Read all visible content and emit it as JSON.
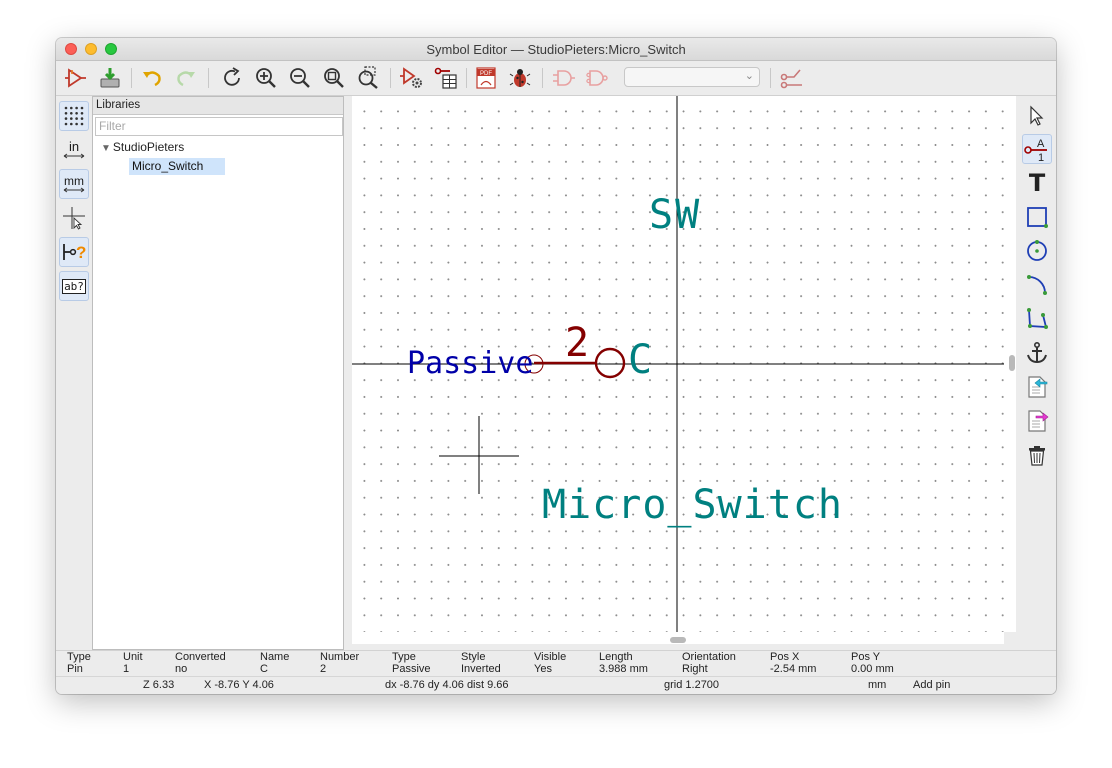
{
  "window": {
    "title": "Symbol Editor — StudioPieters:Micro_Switch"
  },
  "toolbar": {
    "buttons": [
      "new-symbol",
      "save",
      "undo",
      "redo",
      "refresh",
      "zoom-in",
      "zoom-out",
      "zoom-fit",
      "zoom-selection",
      "symbol-properties",
      "pin-table",
      "export-pdf",
      "check-symbol",
      "demorgan-standard",
      "demorgan-alternate",
      "unit-selector",
      "show-pin-electrical-type"
    ],
    "unit_combo_value": ""
  },
  "left_tools": [
    "grid",
    "in",
    "mm",
    "full-cursor",
    "pin-electrical-type",
    "text-properties"
  ],
  "left_tool_labels": {
    "in": "in",
    "mm": "mm",
    "text_props": "ab?"
  },
  "libraries": {
    "header": "Libraries",
    "filter_placeholder": "Filter",
    "library": "StudioPieters",
    "symbol": "Micro_Switch"
  },
  "canvas": {
    "reference": "SW",
    "value": "Micro_Switch",
    "pin_number": "2",
    "pin_name": "C",
    "pin_type_label": "Passive"
  },
  "right_tools": [
    "select",
    "add-pin",
    "add-text",
    "add-rectangle",
    "add-circle",
    "add-arc",
    "add-polyline",
    "set-anchor",
    "import-symbol",
    "export-symbol",
    "delete"
  ],
  "right_tool_labels": {
    "pin_letter": "A",
    "pin_number": "1",
    "text": "T"
  },
  "message_panel": [
    {
      "label": "Type",
      "value": "Pin"
    },
    {
      "label": "Unit",
      "value": "1"
    },
    {
      "label": "Converted",
      "value": "no"
    },
    {
      "label": "Name",
      "value": "C"
    },
    {
      "label": "Number",
      "value": "2"
    },
    {
      "label": "Type",
      "value": "Passive"
    },
    {
      "label": "Style",
      "value": "Inverted"
    },
    {
      "label": "Visible",
      "value": "Yes"
    },
    {
      "label": "Length",
      "value": "3.988 mm"
    },
    {
      "label": "Orientation",
      "value": "Right"
    },
    {
      "label": "Pos X",
      "value": "-2.54 mm"
    },
    {
      "label": "Pos Y",
      "value": "0.00 mm"
    }
  ],
  "status": {
    "zoom": "Z 6.33",
    "cursor": "X -8.76  Y 4.06",
    "delta": "dx -8.76  dy 4.06  dist 9.66",
    "grid": "grid 1.2700",
    "units": "mm",
    "mode": "Add pin"
  },
  "colors": {
    "reference_text": "#008080",
    "value_text": "#008080",
    "pin_color": "#840000",
    "pin_type_text": "#0000a8",
    "selection": "#cfe4fb"
  }
}
